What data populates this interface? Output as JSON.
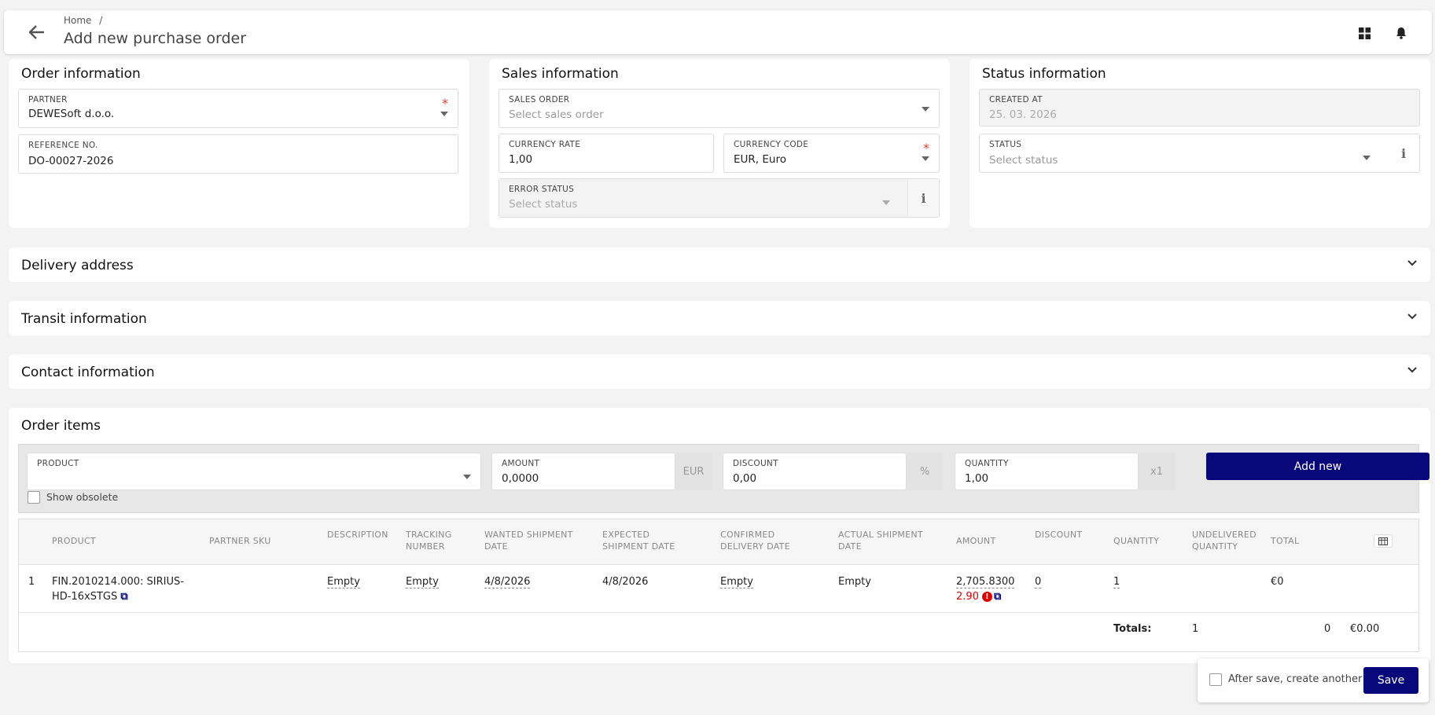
{
  "header": {
    "breadcrumb_home": "Home",
    "breadcrumb_sep": "/",
    "title": "Add new purchase order",
    "icons": [
      "back-arrow-icon",
      "grid-icon",
      "bell-icon"
    ]
  },
  "order_info": {
    "title": "Order information",
    "partner_label": "PARTNER",
    "partner_value": "DEWESoft d.o.o.",
    "reference_label": "REFERENCE NO.",
    "reference_value": "DO-00027-2026"
  },
  "sales_info": {
    "title": "Sales information",
    "sales_order_label": "SALES ORDER",
    "sales_order_placeholder": "Select sales order",
    "currency_rate_label": "CURRENCY RATE",
    "currency_rate_value": "1,00",
    "currency_code_label": "CURRENCY CODE",
    "currency_code_value": "EUR, Euro",
    "error_status_label": "ERROR STATUS",
    "error_status_placeholder": "Select status"
  },
  "status_info": {
    "title": "Status information",
    "created_at_label": "CREATED AT",
    "created_at_value": "25. 03. 2026",
    "status_label": "STATUS",
    "status_placeholder": "Select status"
  },
  "sections": {
    "delivery": "Delivery address",
    "transit": "Transit information",
    "contact": "Contact information"
  },
  "order_items": {
    "title": "Order items",
    "product_label": "PRODUCT",
    "amount_label": "AMOUNT",
    "amount_value": "0,0000",
    "amount_suffix": "EUR",
    "discount_label": "DISCOUNT",
    "discount_value": "0,00",
    "discount_suffix": "%",
    "quantity_label": "QUANTITY",
    "quantity_value": "1,00",
    "quantity_suffix": "x1",
    "add_new": "Add new",
    "show_obsolete": "Show obsolete"
  },
  "table": {
    "columns": {
      "product": "PRODUCT",
      "partner_sku": "PARTNER SKU",
      "description": "DESCRIPTION",
      "tracking_1": "TRACKING",
      "tracking_2": "NUMBER",
      "wanted_1": "WANTED SHIPMENT",
      "wanted_2": "DATE",
      "expected_1": "EXPECTED",
      "expected_2": "SHIPMENT DATE",
      "confirmed_1": "CONFIRMED",
      "confirmed_2": "DELIVERY DATE",
      "actual_1": "ACTUAL SHIPMENT",
      "actual_2": "DATE",
      "amount": "AMOUNT",
      "discount": "DISCOUNT",
      "quantity": "QUANTITY",
      "undelivered_1": "UNDELIVERED",
      "undelivered_2": "QUANTITY",
      "total": "TOTAL"
    },
    "row": {
      "index": "1",
      "product_line1": "FIN.2010214.000: SIRIUS-",
      "product_line2": "HD-16xSTGS",
      "description": "Empty",
      "tracking": "Empty",
      "wanted": "4/8/2026",
      "expected": "4/8/2026",
      "confirmed": "Empty",
      "actual": "Empty",
      "amount": "2,705.8300",
      "amount_warning": "2.90",
      "discount": "0",
      "quantity": "1",
      "total": "€0"
    },
    "totals": {
      "label": "Totals:",
      "quantity": "1",
      "undelivered": "0",
      "total": "€0.00"
    }
  },
  "footer": {
    "after_save_label": "After save, create another",
    "save": "Save"
  },
  "colors": {
    "primary": "#08087a",
    "required": "#e53935",
    "warning": "#e00000"
  }
}
